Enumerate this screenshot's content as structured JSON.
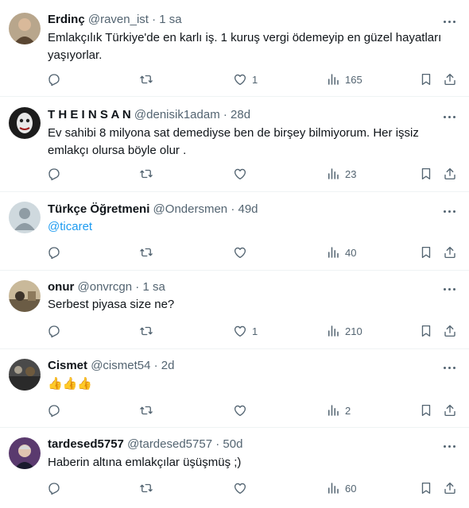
{
  "tweets": [
    {
      "name": "Erdinç",
      "handle": "@raven_ist",
      "dot": "·",
      "time": "1 sa",
      "text": "Emlakçılık Türkiye'de en karlı iş. 1 kuruş vergi ödemeyip en güzel hayatları yaşıyorlar.",
      "replies": "",
      "retweets": "",
      "likes": "1",
      "views": "165",
      "avatar_color": "#8a6a4a"
    },
    {
      "name": "T H E I N S A N",
      "handle": "@denisik1adam",
      "dot": "·",
      "time": "28d",
      "text": "Ev sahibi 8 milyona sat demediyse ben de birşey bilmiyorum. Her işsiz emlakçı olursa böyle olur .",
      "replies": "",
      "retweets": "",
      "likes": "",
      "views": "23",
      "avatar_color": "#1c1c1c"
    },
    {
      "name": "Türkçe Öğretmeni",
      "handle": "@Ondersmen",
      "dot": "·",
      "time": "49d",
      "text": "@ticaret",
      "replies": "",
      "retweets": "",
      "likes": "",
      "views": "40",
      "avatar_color": "#cfd9de"
    },
    {
      "name": "onur",
      "handle": "@onvrcgn",
      "dot": "·",
      "time": "1 sa",
      "text": "Serbest piyasa size ne?",
      "replies": "",
      "retweets": "",
      "likes": "1",
      "views": "210",
      "avatar_color": "#7a6e5e"
    },
    {
      "name": "Cismet",
      "handle": "@cismet54",
      "dot": "·",
      "time": "2d",
      "text": "👍👍👍",
      "replies": "",
      "retweets": "",
      "likes": "",
      "views": "2",
      "avatar_color": "#3a3a3a"
    },
    {
      "name": "tardesed5757",
      "handle": "@tardesed5757",
      "dot": "·",
      "time": "50d",
      "text": "Haberin altına emlakçılar üşüşmüş ;)",
      "replies": "",
      "retweets": "",
      "likes": "",
      "views": "60",
      "avatar_color": "#5a3a6e"
    }
  ],
  "colors": {
    "text": "#0f1419",
    "muted": "#536471",
    "link": "#1d9bf0",
    "divider": "#eff3f4"
  },
  "icons": [
    "reply-icon",
    "retweet-icon",
    "like-icon",
    "views-icon",
    "bookmark-icon",
    "share-icon",
    "more-icon"
  ]
}
